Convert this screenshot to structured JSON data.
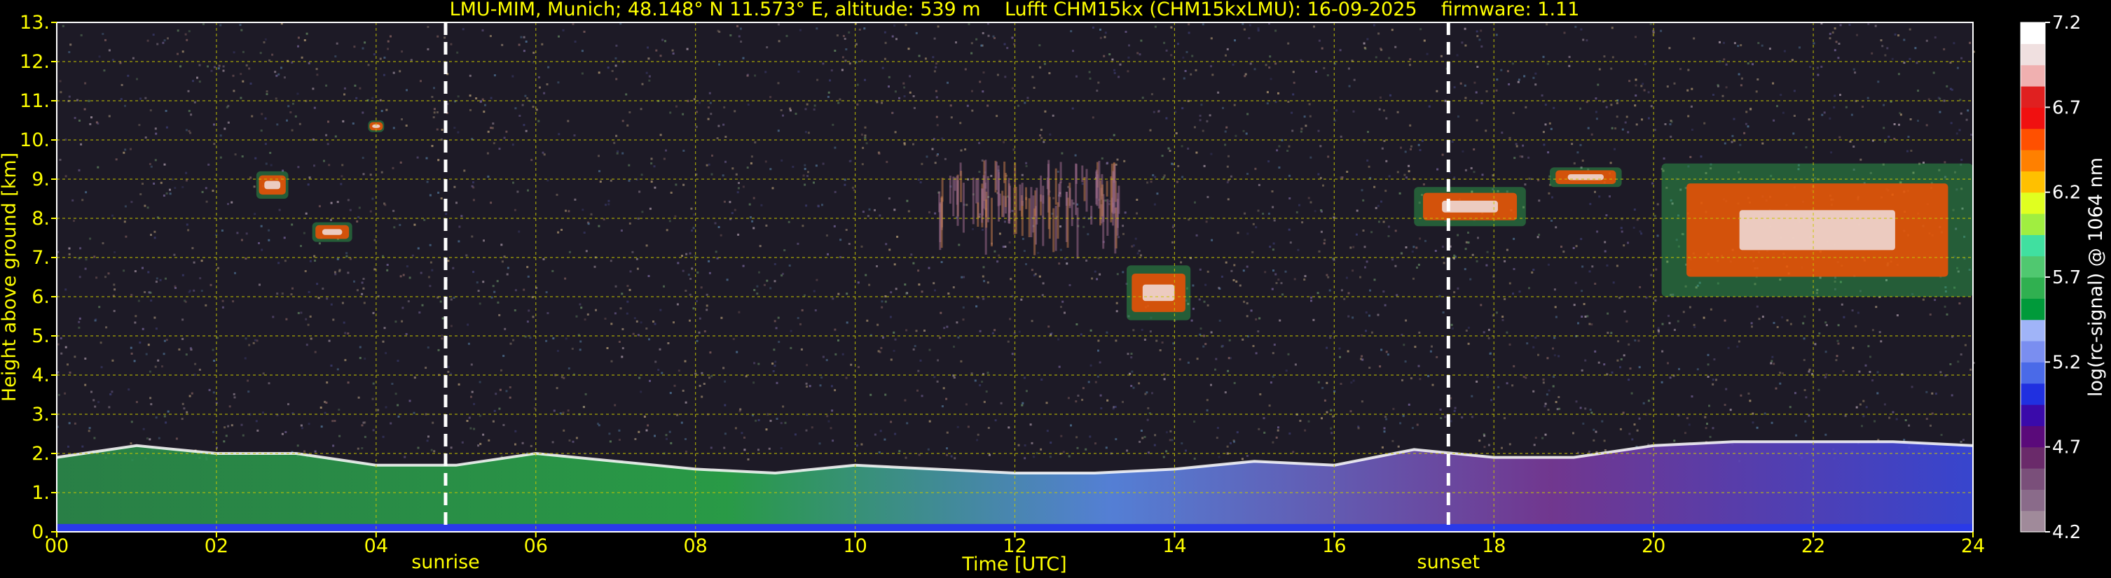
{
  "chart_data": {
    "type": "heatmap",
    "title": "LMU-MIM, Munich; 48.148° N 11.573° E, altitude: 539 m    Lufft CHM15kx (CHM15kxLMU): 16-09-2025    firmware: 1.11",
    "xlabel": "Time [UTC]",
    "ylabel": "Height above ground [km]",
    "xlim": [
      0,
      24
    ],
    "ylim": [
      0,
      13
    ],
    "x_ticks": [
      "00",
      "02",
      "04",
      "06",
      "08",
      "10",
      "12",
      "14",
      "16",
      "18",
      "20",
      "22",
      "24"
    ],
    "y_ticks": [
      "0.",
      "1.",
      "2.",
      "3.",
      "4.",
      "5.",
      "6.",
      "7.",
      "8.",
      "9.",
      "10.",
      "11.",
      "12.",
      "13."
    ],
    "grid": true,
    "markers": [
      {
        "label": "sunrise",
        "time": 4.87
      },
      {
        "label": "sunset",
        "time": 17.43
      }
    ],
    "colorbar": {
      "label": "log(rc-signal) @ 1064 nm",
      "range": [
        4.2,
        7.2
      ],
      "ticks": [
        "4.2",
        "4.7",
        "5.2",
        "5.7",
        "6.2",
        "6.7",
        "7.2"
      ],
      "colors": [
        "#a08a9a",
        "#8a6b8a",
        "#7a4f7a",
        "#6a2a6a",
        "#5a0a7a",
        "#3a0aaa",
        "#2030e0",
        "#4a6ae8",
        "#7a8ef0",
        "#a0b4f8",
        "#009a3a",
        "#30b050",
        "#50c870",
        "#40e0a0",
        "#a0ee40",
        "#e0ff20",
        "#ffc000",
        "#ff8000",
        "#ff5000",
        "#f01010",
        "#e02020",
        "#f0b0b0",
        "#f0e0e0",
        "#ffffff"
      ]
    },
    "features": [
      {
        "kind": "boundary_layer",
        "start": 0,
        "end": 24,
        "top_km": [
          1.9,
          2.2,
          2.0,
          2.0,
          1.7,
          1.7,
          2.0,
          1.8,
          1.6,
          1.5,
          1.7,
          1.6,
          1.5,
          1.5,
          1.6,
          1.8,
          1.7,
          2.1,
          1.9,
          1.9,
          2.2,
          2.3,
          2.3,
          2.3,
          2.2
        ]
      },
      {
        "kind": "cloud",
        "start": 3.2,
        "end": 3.7,
        "bottom": 7.4,
        "top": 7.9
      },
      {
        "kind": "cloud",
        "start": 3.9,
        "end": 4.1,
        "bottom": 10.2,
        "top": 10.5
      },
      {
        "kind": "cloud",
        "start": 2.5,
        "end": 2.9,
        "bottom": 8.5,
        "top": 9.2
      },
      {
        "kind": "cloud",
        "start": 13.4,
        "end": 14.2,
        "bottom": 5.4,
        "top": 6.8
      },
      {
        "kind": "cloud",
        "start": 17.0,
        "end": 18.4,
        "bottom": 7.8,
        "top": 8.8
      },
      {
        "kind": "cloud",
        "start": 18.7,
        "end": 19.6,
        "bottom": 8.8,
        "top": 9.3
      },
      {
        "kind": "cloud",
        "start": 20.1,
        "end": 24.0,
        "bottom": 6.0,
        "top": 9.4
      },
      {
        "kind": "virga",
        "start": 11.0,
        "end": 13.3,
        "bottom": 7.0,
        "top": 9.5
      }
    ]
  }
}
